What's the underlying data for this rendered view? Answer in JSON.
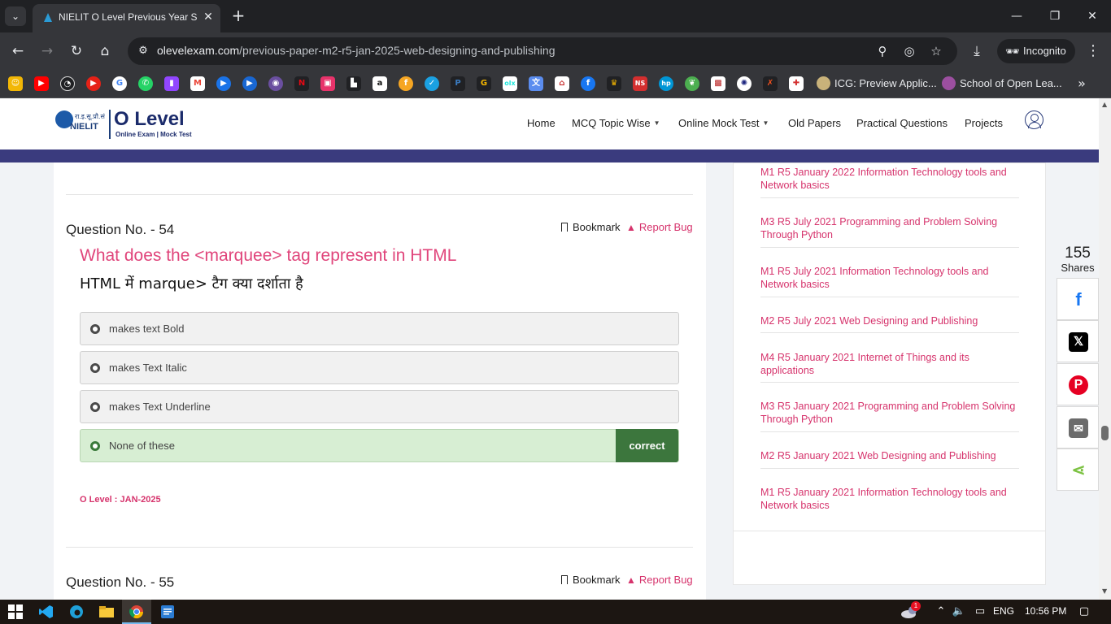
{
  "browser": {
    "tab_title": "NIELIT O Level Previous Year So",
    "url_host": "olevelexam.com",
    "url_path": "/previous-paper-m2-r5-jan-2025-web-designing-and-publishing",
    "incognito_label": "Incognito",
    "bookmarks_text": [
      "ICG: Preview Applic...",
      "School of Open Lea..."
    ]
  },
  "site": {
    "logo_hindi": "रा.इ.सू.प्रौ.सं",
    "logo_nielit": "NIELIT",
    "logo_title": "O Level",
    "logo_tagline": "Online Exam | Mock Test",
    "nav": [
      "Home",
      "MCQ Topic Wise",
      "Online Mock Test",
      "Old Papers",
      "Practical Questions",
      "Projects"
    ]
  },
  "question": {
    "number_label": "Question No. - 54",
    "bookmark_label": "Bookmark",
    "report_label": "Report Bug",
    "text_en": "What does the <marquee> tag represent in HTML",
    "text_hi": "HTML में marque> टैग क्या दर्शाता है",
    "options": [
      "makes text Bold",
      "makes Text Italic",
      "makes Text Underline",
      "None of these"
    ],
    "correct_label": "correct",
    "source": "O Level : JAN-2025"
  },
  "next_question": {
    "number_label": "Question No. - 55",
    "bookmark_label": "Bookmark",
    "report_label": "Report Bug"
  },
  "sidebar": {
    "links": [
      "M1 R5 January 2022 Information Technology tools and Network basics",
      "M3 R5 July 2021 Programming and Problem Solving Through Python",
      "M1 R5 July 2021 Information Technology tools and Network basics",
      "M2 R5 July 2021 Web Designing and Publishing",
      "M4 R5 January 2021 Internet of Things and its applications",
      "M3 R5 January 2021 Programming and Problem Solving Through Python",
      "M2 R5 January 2021 Web Designing and Publishing",
      "M1 R5 January 2021 Information Technology tools and Network basics"
    ]
  },
  "share": {
    "count": "155",
    "label": "Shares"
  },
  "taskbar": {
    "language": "ENG",
    "time": "10:56 PM",
    "weather_badge": "1"
  },
  "colors": {
    "accent_pink": "#d6336c",
    "question_pink": "#e0457b",
    "brand_bar": "#3a3b7e",
    "correct_green": "#3c763d",
    "correct_bg": "#d7eed3"
  }
}
